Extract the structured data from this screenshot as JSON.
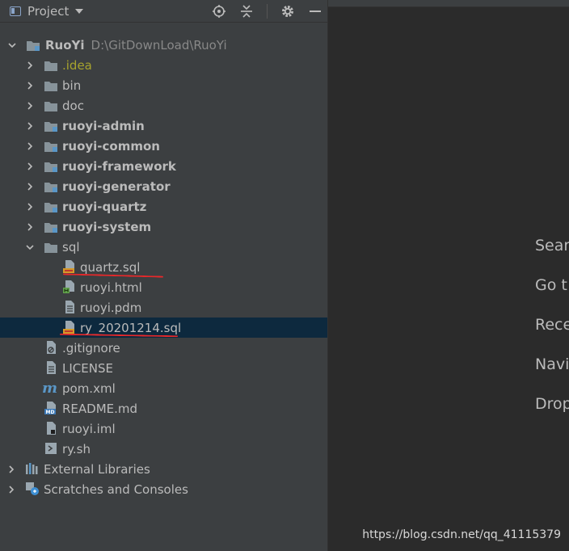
{
  "header": {
    "title": "Project"
  },
  "tree": {
    "root": {
      "name": "RuoYi",
      "path": "D:\\GitDownLoad\\RuoYi"
    },
    "items": [
      {
        "label": ".idea"
      },
      {
        "label": "bin"
      },
      {
        "label": "doc"
      },
      {
        "label": "ruoyi-admin"
      },
      {
        "label": "ruoyi-common"
      },
      {
        "label": "ruoyi-framework"
      },
      {
        "label": "ruoyi-generator"
      },
      {
        "label": "ruoyi-quartz"
      },
      {
        "label": "ruoyi-system"
      },
      {
        "label": "sql"
      },
      {
        "label": "quartz.sql"
      },
      {
        "label": "ruoyi.html"
      },
      {
        "label": "ruoyi.pdm"
      },
      {
        "label": "ry_20201214.sql"
      },
      {
        "label": ".gitignore"
      },
      {
        "label": "LICENSE"
      },
      {
        "label": "pom.xml"
      },
      {
        "label": "README.md"
      },
      {
        "label": "ruoyi.iml"
      },
      {
        "label": "ry.sh"
      },
      {
        "label": "External Libraries"
      },
      {
        "label": "Scratches and Consoles"
      }
    ]
  },
  "hints": [
    "Sear",
    "Go t",
    "Rece",
    "Navi",
    "Drop"
  ],
  "watermark": "https://blog.csdn.net/qq_41115379",
  "colors": {
    "panel_bg": "#3c3f41",
    "editor_bg": "#2b2b2b",
    "selection": "#0d293e",
    "folder": "#87939a",
    "module_badge": "#5a97c7",
    "annotation": "#e8282a"
  }
}
